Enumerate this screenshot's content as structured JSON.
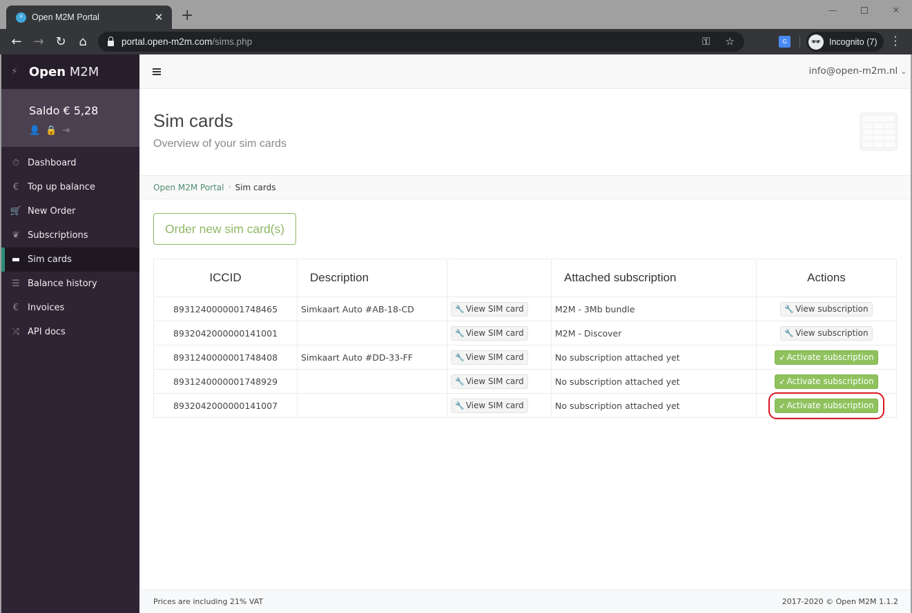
{
  "browser": {
    "tab_title": "Open M2M Portal",
    "url_host": "portal.open-m2m.com",
    "url_path": "/sims.php",
    "incognito_label": "Incognito (7)"
  },
  "sidebar": {
    "brand_bold": "Open",
    "brand_light": "M2M",
    "saldo": "Saldo € 5,28",
    "items": [
      {
        "label": "Dashboard",
        "icon": "stopwatch-icon",
        "glyph": "⏱"
      },
      {
        "label": "Top up balance",
        "icon": "euro-icon",
        "glyph": "€"
      },
      {
        "label": "New Order",
        "icon": "cart-icon",
        "glyph": "🛒"
      },
      {
        "label": "Subscriptions",
        "icon": "leaf-icon",
        "glyph": "❦"
      },
      {
        "label": "Sim cards",
        "icon": "credit-card-icon",
        "glyph": "▬",
        "active": true
      },
      {
        "label": "Balance history",
        "icon": "list-icon",
        "glyph": "☰"
      },
      {
        "label": "Invoices",
        "icon": "euro-icon",
        "glyph": "€"
      },
      {
        "label": "API docs",
        "icon": "shuffle-icon",
        "glyph": "⤨"
      }
    ]
  },
  "topbar": {
    "user_email": "info@open-m2m.nl"
  },
  "header": {
    "title": "Sim cards",
    "subtitle": "Overview of your sim cards"
  },
  "breadcrumb": {
    "root": "Open M2M Portal",
    "current": "Sim cards"
  },
  "content": {
    "order_button": "Order new sim card(s)",
    "table": {
      "headers": [
        "ICCID",
        "Description",
        "",
        "Attached subscription",
        "Actions"
      ],
      "view_sim_label": "View SIM card",
      "rows": [
        {
          "iccid": "8931240000001748465",
          "description": "Simkaart Auto #AB-18-CD",
          "subscription": "M2M - 3Mb bundle",
          "action": "View subscription",
          "action_type": "view"
        },
        {
          "iccid": "8932042000000141001",
          "description": "",
          "subscription": "M2M - Discover",
          "action": "View subscription",
          "action_type": "view"
        },
        {
          "iccid": "8931240000001748408",
          "description": "Simkaart Auto #DD-33-FF",
          "subscription": "No subscription attached yet",
          "action": "Activate subscription",
          "action_type": "activate"
        },
        {
          "iccid": "8931240000001748929",
          "description": "",
          "subscription": "No subscription attached yet",
          "action": "Activate subscription",
          "action_type": "activate"
        },
        {
          "iccid": "8932042000000141007",
          "description": "",
          "subscription": "No subscription attached yet",
          "action": "Activate subscription",
          "action_type": "activate",
          "highlighted": true
        }
      ]
    }
  },
  "footer": {
    "left": "Prices are including 21% VAT",
    "right": "2017-2020 © Open M2M 1.1.2"
  },
  "colors": {
    "accent_green": "#8fc25d",
    "sidebar_bg": "#2e2433",
    "active_marker": "#2d8c78",
    "highlight_red": "#d9161c"
  }
}
